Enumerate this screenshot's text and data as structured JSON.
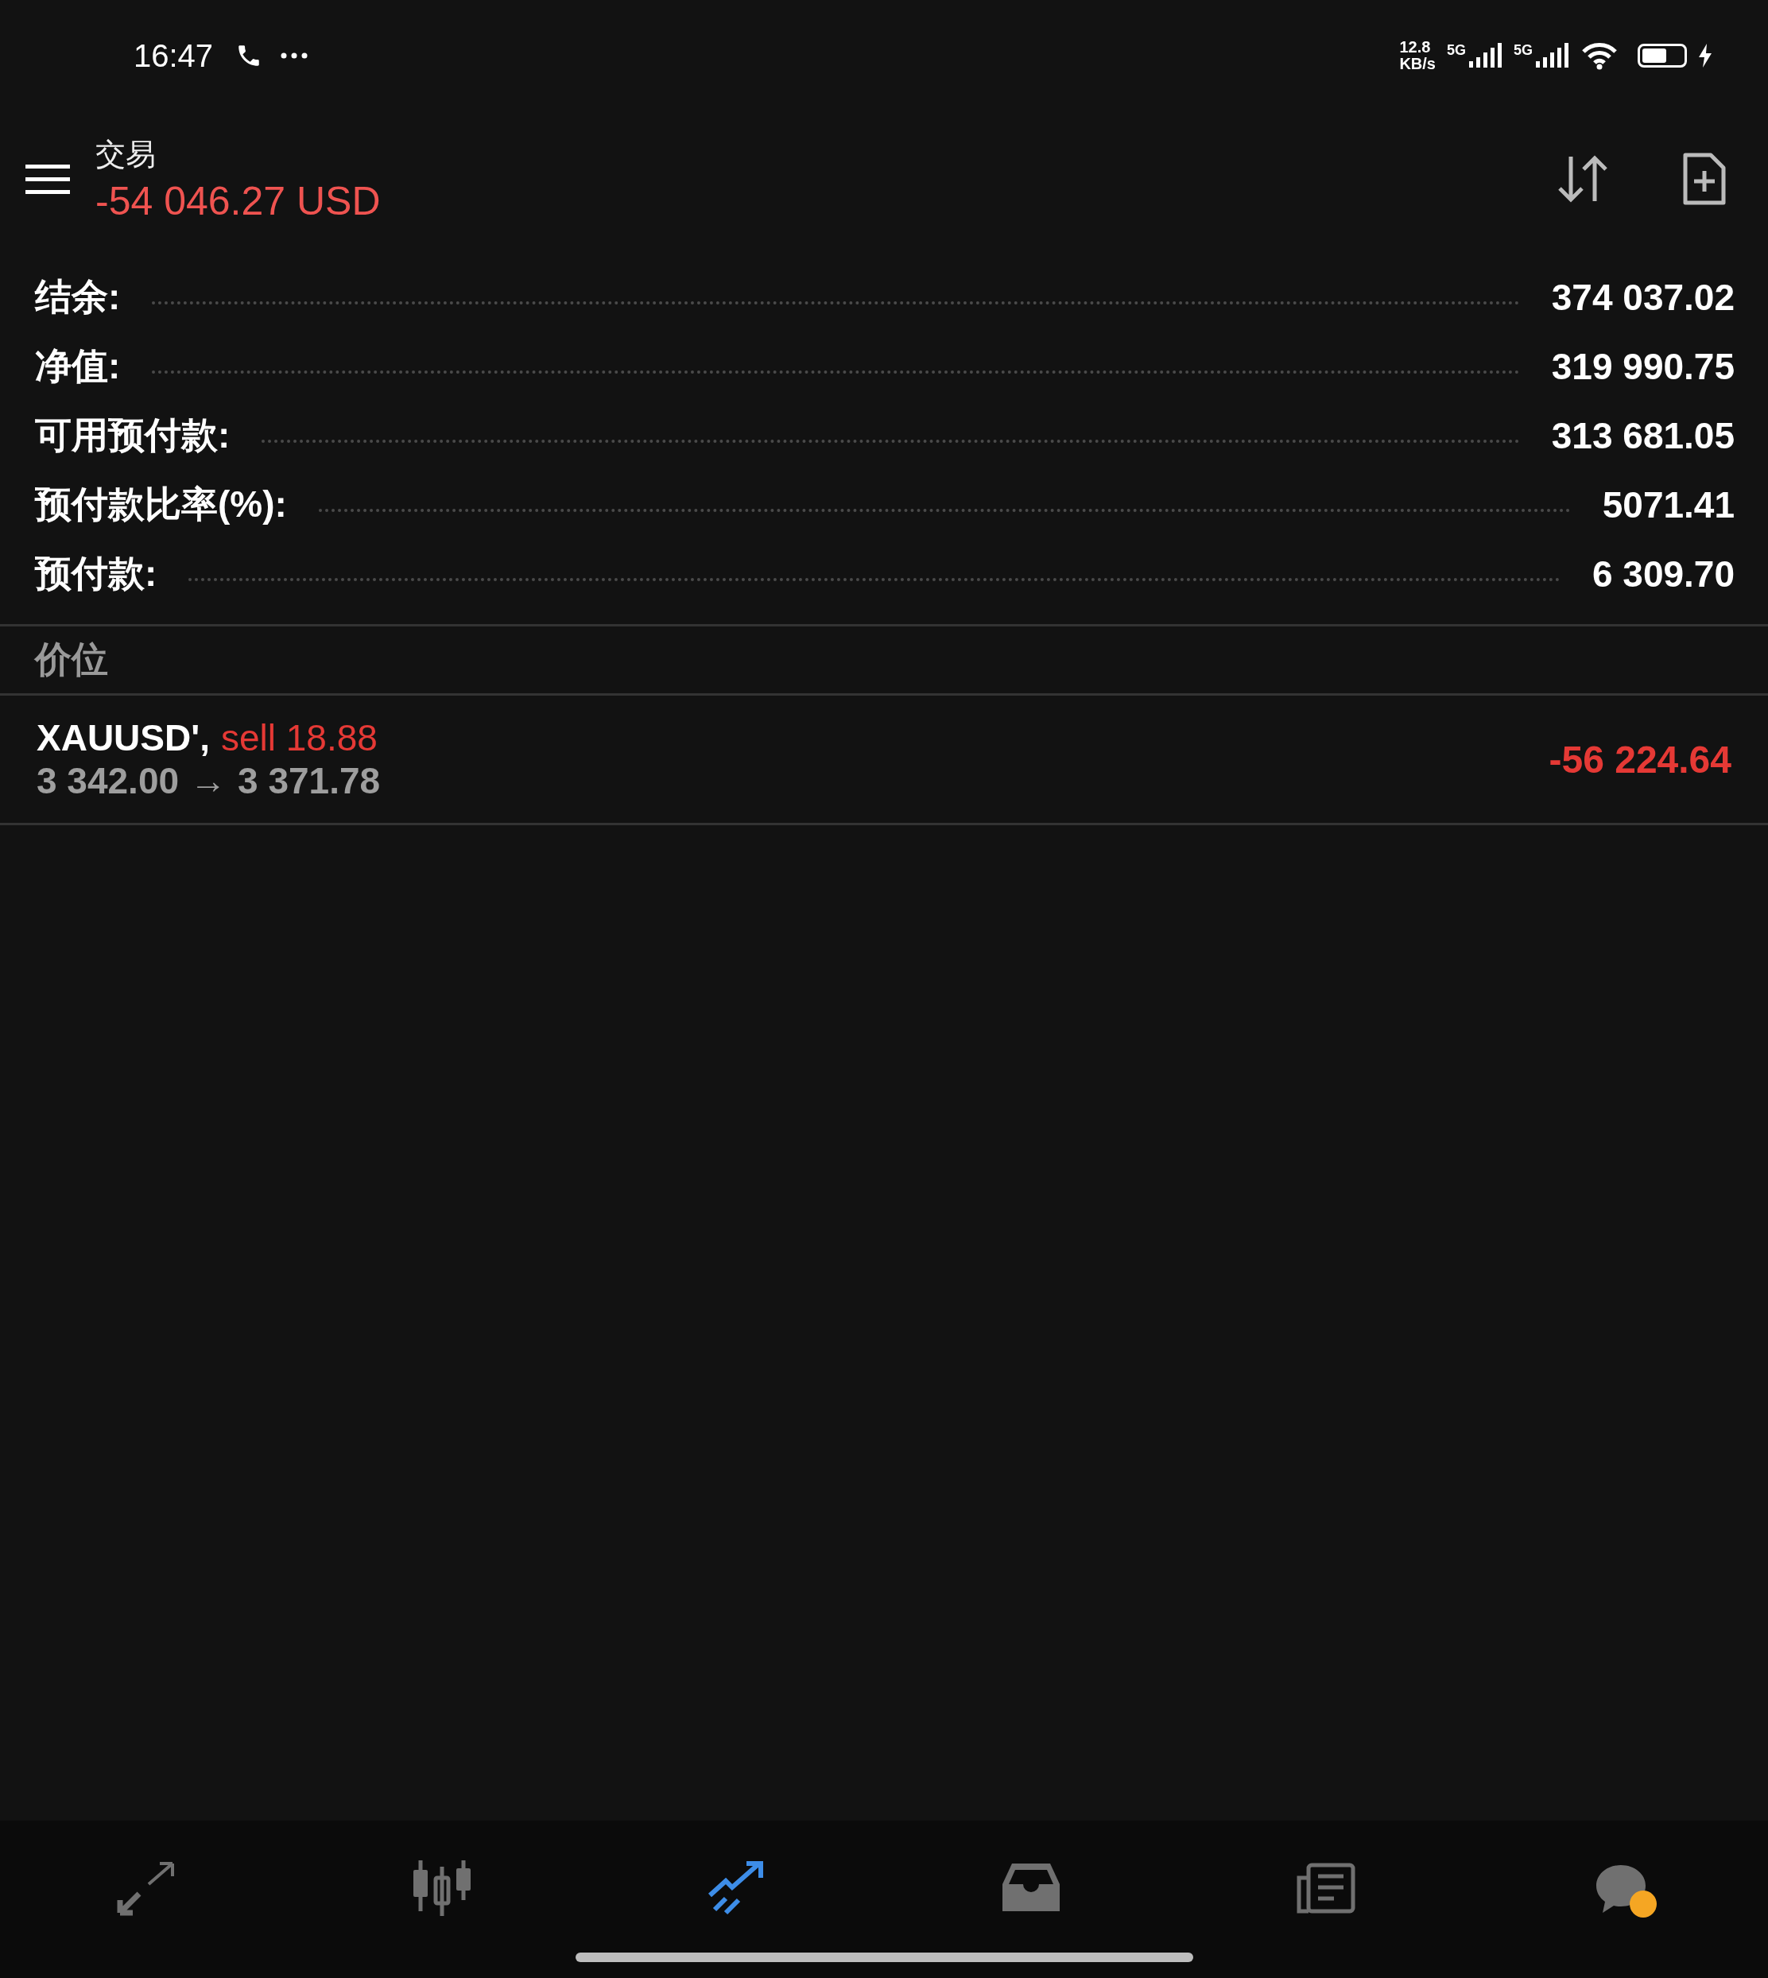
{
  "status_bar": {
    "time": "16:47",
    "speed_value": "12.8",
    "speed_unit": "KB/s",
    "network_1": "5G",
    "network_2": "5G",
    "charging": true
  },
  "header": {
    "title": "交易",
    "profit": "-54 046.27 USD"
  },
  "summary": [
    {
      "label": "结余:",
      "value": "374 037.02"
    },
    {
      "label": "净值:",
      "value": "319 990.75"
    },
    {
      "label": "可用预付款:",
      "value": "313 681.05"
    },
    {
      "label": "预付款比率(%):",
      "value": "5071.41"
    },
    {
      "label": "预付款:",
      "value": "6 309.70"
    }
  ],
  "section_title": "价位",
  "positions": [
    {
      "symbol": "XAUUSD',",
      "side": "sell 18.88",
      "open_price": "3 342.00",
      "arrow": "→",
      "current_price": "3 371.78",
      "profit": "-56 224.64"
    }
  ],
  "nav_tabs": [
    {
      "kind": "quotes",
      "selected": false
    },
    {
      "kind": "chart",
      "selected": false
    },
    {
      "kind": "trade",
      "selected": true
    },
    {
      "kind": "history",
      "selected": false
    },
    {
      "kind": "news",
      "selected": false
    },
    {
      "kind": "chat",
      "selected": false
    }
  ]
}
